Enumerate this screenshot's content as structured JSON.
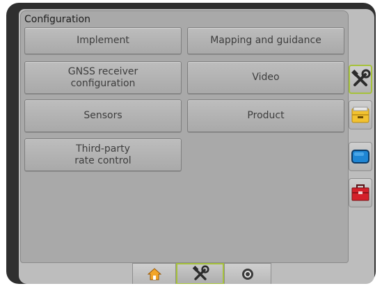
{
  "panel": {
    "title": "Configuration"
  },
  "buttons": {
    "implement": "Implement",
    "mapping": "Mapping and guidance",
    "gnss": "GNSS receiver\nconfiguration",
    "video": "Video",
    "sensors": "Sensors",
    "product": "Product",
    "third_party": "Third-party\nrate control"
  },
  "sidebar": {
    "items": [
      {
        "icon": "tools-icon",
        "active": true
      },
      {
        "icon": "file-drawer-icon",
        "active": false
      },
      {
        "icon": "display-icon",
        "active": false
      },
      {
        "icon": "toolbox-icon",
        "active": false
      }
    ]
  },
  "bottom_tabs": [
    {
      "icon": "home-icon",
      "active": false
    },
    {
      "icon": "tools-icon",
      "active": true
    },
    {
      "icon": "camera-icon",
      "active": false
    }
  ],
  "colors": {
    "active_border": "#a6c23a",
    "drawer": "#f2c230",
    "display": "#1f86d4",
    "toolbox": "#d4202a",
    "home": "#f2a52a"
  }
}
